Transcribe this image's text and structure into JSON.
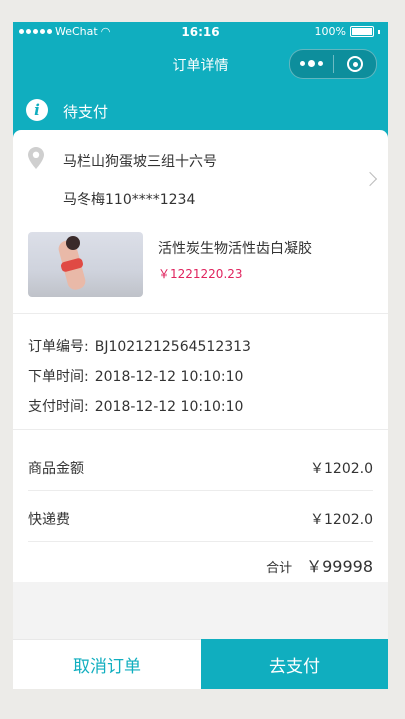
{
  "status_bar": {
    "carrier": "WeChat",
    "time": "16:16",
    "battery": "100%"
  },
  "nav": {
    "title": "订单详情",
    "more_icon": "more-dots-icon",
    "close_icon": "close-circle-icon"
  },
  "order_status": {
    "icon": "info-icon",
    "label": "待支付"
  },
  "address": {
    "line": "马栏山狗蛋坡三组十六号",
    "contact": "马冬梅110****1234"
  },
  "product": {
    "name": "活性炭生物活性齿白凝胶",
    "price": "￥1221220.23"
  },
  "order_info": [
    {
      "label": "订单编号:",
      "value": "BJ1021212564512313"
    },
    {
      "label": "下单时间:",
      "value": "2018-12-12 10:10:10"
    },
    {
      "label": "支付时间:",
      "value": "2018-12-12 10:10:10"
    }
  ],
  "amounts": {
    "goods_label": "商品金额",
    "goods_value": "￥1202.0",
    "shipping_label": "快递费",
    "shipping_value": "￥1202.0",
    "total_label": "合计",
    "total_value": "￥99998"
  },
  "actions": {
    "cancel": "取消订单",
    "pay": "去支付"
  },
  "colors": {
    "accent": "#10aebf",
    "price": "#e0245e"
  }
}
